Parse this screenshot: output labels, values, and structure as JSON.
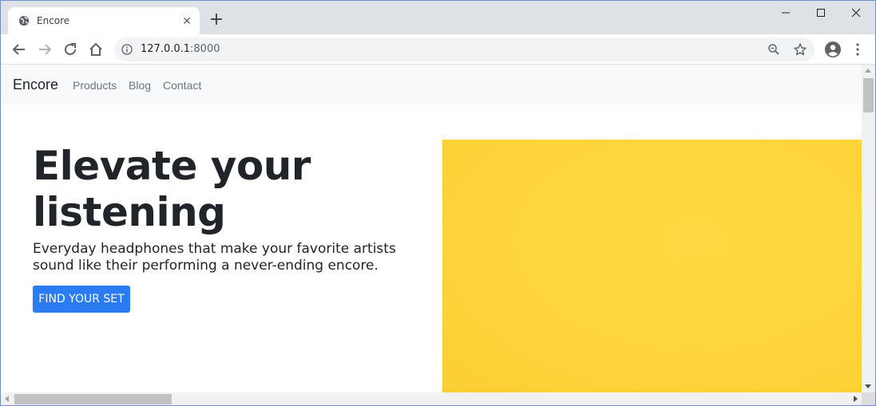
{
  "browser": {
    "tab": {
      "title": "Encore",
      "close_glyph": "✕"
    },
    "new_tab_glyph": "+",
    "address": {
      "host": "127.0.0.1",
      "port": ":8000"
    },
    "icons": {
      "favicon": "globe-icon",
      "back": "back-arrow-icon",
      "forward": "forward-arrow-icon",
      "reload": "reload-icon",
      "home": "home-icon",
      "info": "info-icon",
      "zoom": "zoom-icon",
      "star": "star-icon",
      "profile": "profile-icon",
      "menu": "kebab-menu-icon"
    }
  },
  "site": {
    "brand": "Encore",
    "nav": [
      "Products",
      "Blog",
      "Contact"
    ],
    "hero": {
      "title": "Elevate your listening",
      "subtitle": "Everyday headphones that make your favorite artists sound like their performing a never-ending encore.",
      "cta_label": "FIND YOUR SET",
      "image_color": "#fdd43a"
    },
    "colors": {
      "primary": "#2b7bf3",
      "navbar_bg": "#f8f9fa"
    }
  }
}
